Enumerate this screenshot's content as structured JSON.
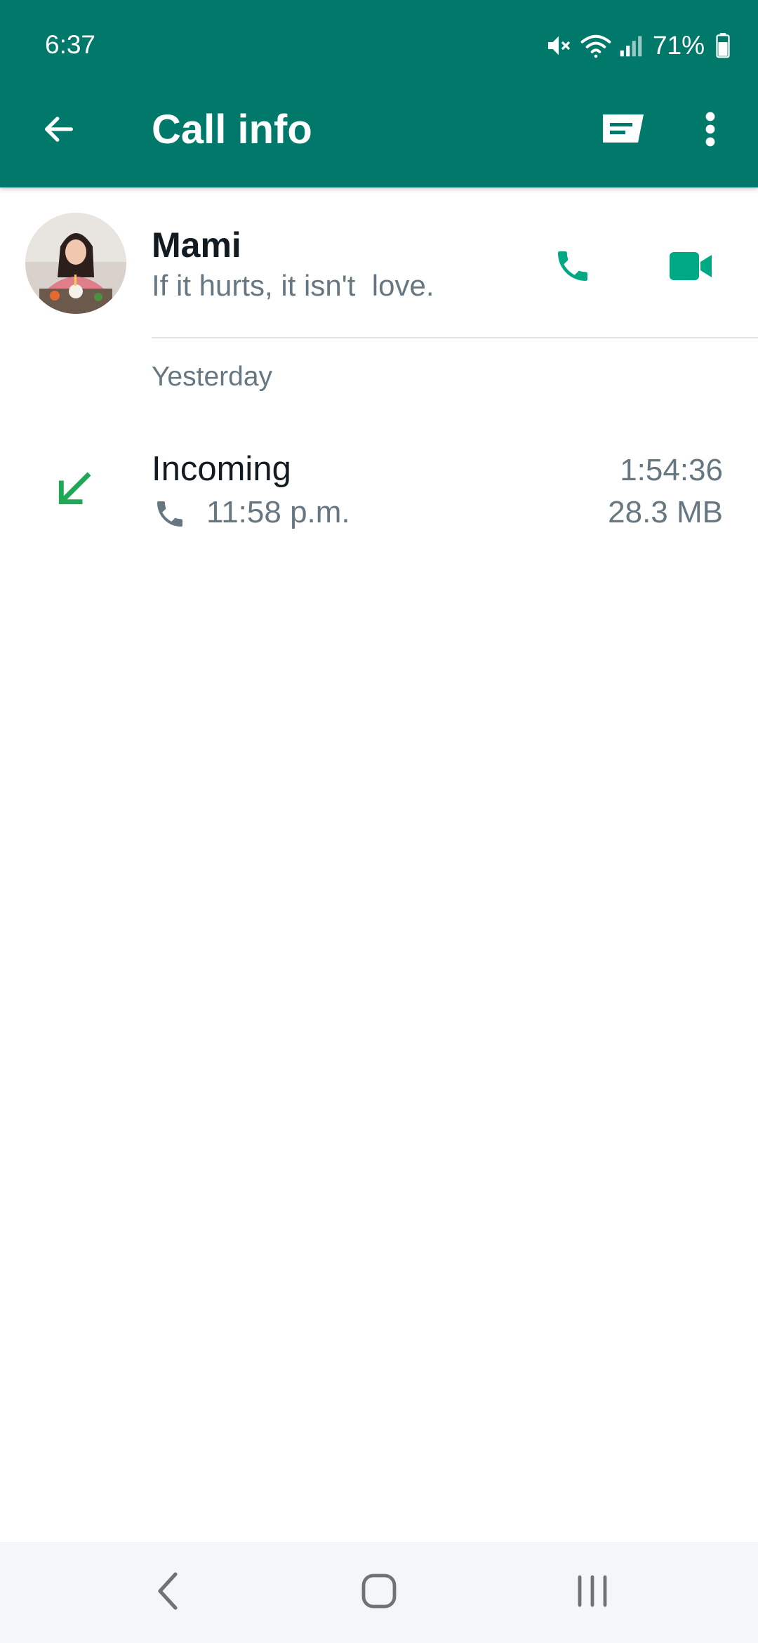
{
  "status_bar": {
    "time": "6:37",
    "battery": "71%",
    "icons": [
      "mute-icon",
      "wifi-icon",
      "signal-icon",
      "battery-icon"
    ]
  },
  "header": {
    "title": "Call info",
    "back_icon": "arrow-left-icon",
    "message_icon": "message-icon",
    "more_icon": "more-vertical-icon"
  },
  "contact": {
    "name": "Mami",
    "status": "If it hurts, it isn't  love.",
    "voice_call_icon": "phone-icon",
    "video_call_icon": "video-icon"
  },
  "calls": {
    "section_label": "Yesterday",
    "items": [
      {
        "direction_icon": "incoming-arrow-icon",
        "type": "Incoming",
        "kind_icon": "phone-icon",
        "time": "11:58 p.m.",
        "duration": "1:54:36",
        "size": "28.3 MB"
      }
    ]
  },
  "colors": {
    "header": "#00796b",
    "accent": "#00a884",
    "incoming_arrow": "#1fa855",
    "secondary_text": "#667781",
    "primary_text": "#111b21"
  },
  "navigation": {
    "icons": [
      "back-nav-icon",
      "home-nav-icon",
      "recents-nav-icon"
    ]
  }
}
